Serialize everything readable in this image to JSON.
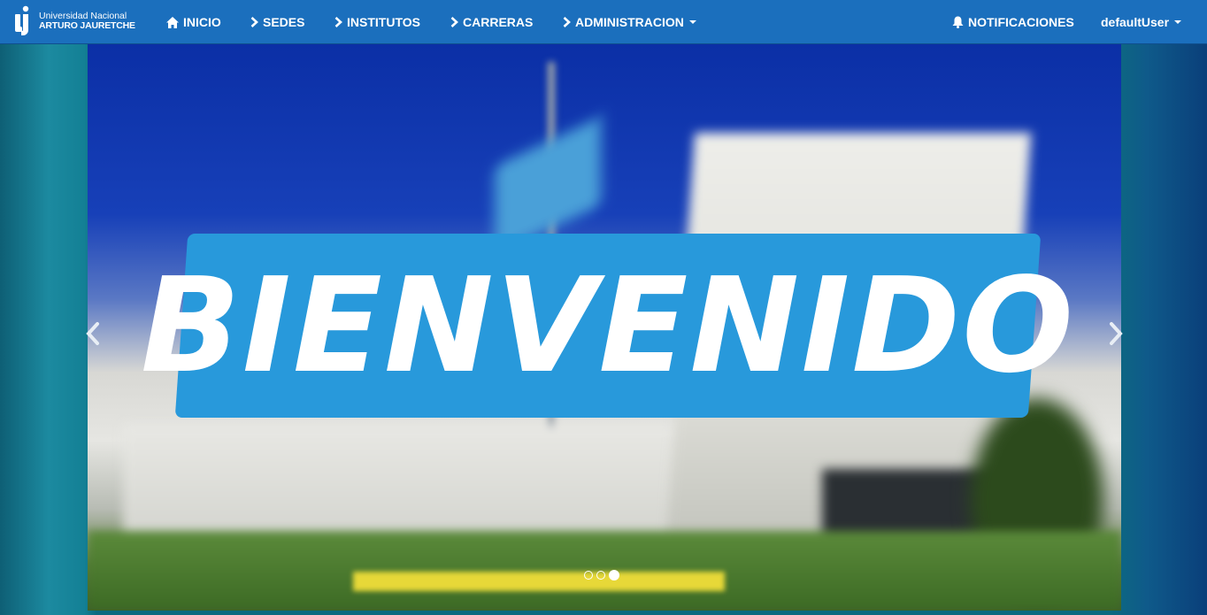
{
  "brand": {
    "line1": "Universidad Nacional",
    "line2": "ARTURO JAURETCHE"
  },
  "nav": {
    "inicio": "INICIO",
    "sedes": "SEDES",
    "institutos": "INSTITUTOS",
    "carreras": "CARRERAS",
    "administracion": "ADMINISTRACION",
    "notificaciones": "NOTIFICACIONES",
    "user": "defaultUser"
  },
  "carousel": {
    "caption": "BIENVENIDO",
    "slide_count": 3,
    "active_slide": 3
  },
  "colors": {
    "navbar": "#1b6fbd",
    "banner": "#2899db"
  }
}
